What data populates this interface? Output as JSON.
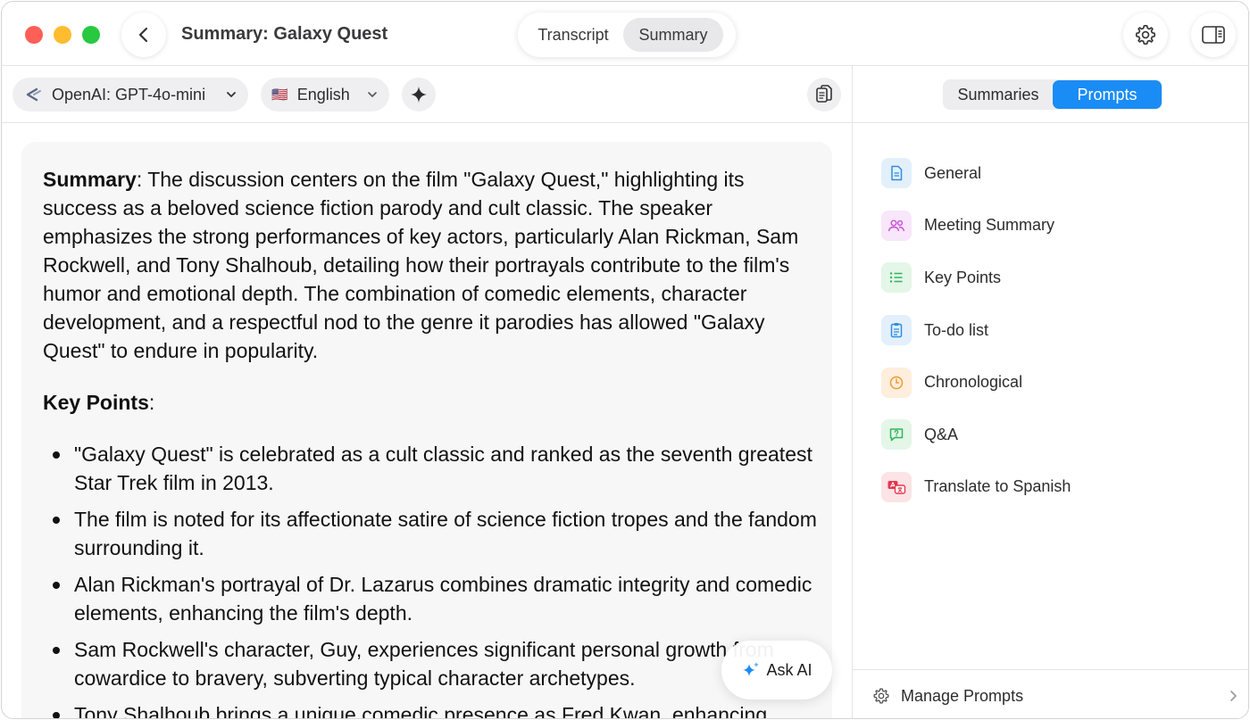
{
  "window": {
    "title": "Summary: Galaxy Quest"
  },
  "view_tabs": [
    {
      "label": "Transcript",
      "active": false
    },
    {
      "label": "Summary",
      "active": true
    }
  ],
  "toolbar": {
    "model": {
      "label": "OpenAI: GPT-4o-mini",
      "icon": "openai-logo-icon"
    },
    "language": {
      "label": "English",
      "flag": "🇺🇸"
    }
  },
  "summary": {
    "summary_heading": "Summary",
    "summary_text": ": The discussion centers on the film \"Galaxy Quest,\" highlighting its success as a beloved science fiction parody and cult classic. The speaker emphasizes the strong performances of key actors, particularly Alan Rickman, Sam Rockwell, and Tony Shalhoub, detailing how their portrayals contribute to the film's humor and emotional depth. The combination of comedic elements, character development, and a respectful nod to the genre it parodies has allowed \"Galaxy Quest\" to endure in popularity.",
    "key_points_heading": "Key Points",
    "key_points_colon": ":",
    "key_points": [
      "\"Galaxy Quest\" is celebrated as a cult classic and ranked as the seventh greatest Star Trek film in 2013.",
      "The film is noted for its affectionate satire of science fiction tropes and the fandom surrounding it.",
      "Alan Rickman's portrayal of Dr. Lazarus combines dramatic integrity and comedic elements, enhancing the film's depth.",
      "Sam Rockwell's character, Guy, experiences significant personal growth from cowardice to bravery, subverting typical character archetypes.",
      "Tony Shalhoub brings a unique comedic presence as Fred Kwan, enhancing"
    ]
  },
  "ask_ai": {
    "label": "Ask AI"
  },
  "right_panel": {
    "tabs": [
      {
        "label": "Summaries",
        "active": false
      },
      {
        "label": "Prompts",
        "active": true
      }
    ],
    "prompts": [
      {
        "label": "General",
        "icon": "document-icon",
        "color": "#2f8ee0",
        "bg": "#e3f0fc"
      },
      {
        "label": "Meeting Summary",
        "icon": "people-icon",
        "color": "#c84ed6",
        "bg": "#f8e6fa"
      },
      {
        "label": "Key Points",
        "icon": "list-icon",
        "color": "#34b35a",
        "bg": "#e3f6e8"
      },
      {
        "label": "To-do list",
        "icon": "clipboard-icon",
        "color": "#2f8ee0",
        "bg": "#e3f0fc"
      },
      {
        "label": "Chronological",
        "icon": "clock-icon",
        "color": "#f09a2e",
        "bg": "#fdeedd"
      },
      {
        "label": "Q&A",
        "icon": "question-bubble-icon",
        "color": "#34b35a",
        "bg": "#e3f6e8"
      },
      {
        "label": "Translate to Spanish",
        "icon": "translate-icon",
        "color": "#e5374b",
        "bg": "#fbe3e6"
      }
    ],
    "manage": {
      "label": "Manage Prompts"
    }
  }
}
